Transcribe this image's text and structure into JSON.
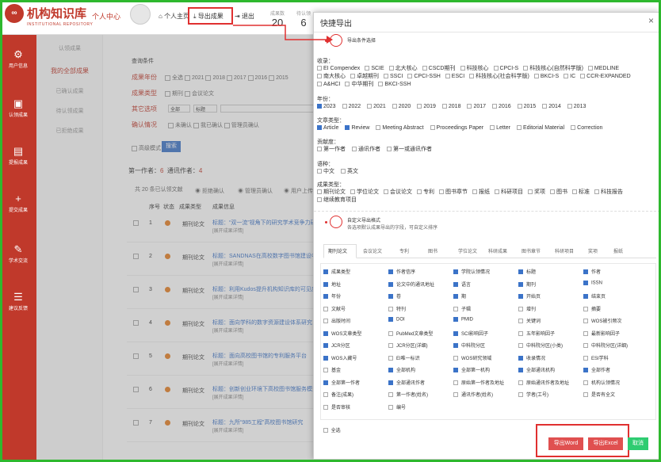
{
  "topbar": {
    "logo_text": "∞",
    "brand": "机构知识库",
    "brand_sub": "INSTITUTIONAL REPOSITORY",
    "user_center": "个人中心",
    "nav_home": "个人主页",
    "nav_export": "导出成果",
    "nav_logout": "退出",
    "stats": [
      {
        "label": "成果数",
        "value": "20"
      },
      {
        "label": "待认领",
        "value": "6"
      }
    ]
  },
  "sidebar": {
    "items": [
      {
        "icon": "⚙",
        "label": "用户信息"
      },
      {
        "icon": "▣",
        "label": "认领成果"
      },
      {
        "icon": "▤",
        "label": "提报成果"
      },
      {
        "icon": "+",
        "label": "提交成果"
      },
      {
        "icon": "✎",
        "label": "学术交流"
      },
      {
        "icon": "☰",
        "label": "建议反馈"
      }
    ]
  },
  "subnav": {
    "header": "认领成果",
    "all": "我的全部成果",
    "items": [
      "已确认成果",
      "待认领成果",
      "已拒绝成果"
    ]
  },
  "main": {
    "query_title": "查询条件",
    "label_year": "成果年份",
    "label_type": "成果类型",
    "label_other": "其它选项",
    "label_claim": "确认情况",
    "years": [
      "全选",
      "2021",
      "2018",
      "2017",
      "2016",
      "2015"
    ],
    "types": [
      "期刊",
      "会议论文"
    ],
    "other_select1": "全部",
    "other_select2": "标题",
    "claim_opts": [
      "未确认",
      "我已确认",
      "管理员确认"
    ],
    "advanced": "高级模式",
    "search": "搜索",
    "first_author": "第一作者：",
    "first_author_val": "6",
    "corr_author": "通讯作者：",
    "corr_author_val": "4",
    "total": "共 20 条已认领文献",
    "action1": "拒绝确认",
    "action2": "管理员确认",
    "action3": "用户上传",
    "col_num": "序号",
    "col_status": "状态",
    "col_type": "成果类型",
    "col_info": "成果信息",
    "rows": [
      {
        "num": "1",
        "type": "期刊论文",
        "title": "标题：“双一流”视角下的研究学术竞争力研究……",
        "sub": "[展开成果详情]"
      },
      {
        "num": "2",
        "type": "期刊论文",
        "title": "标题：SANDNAS在高校数字图书馆建设中的应用研究",
        "sub": "[展开成果详情]"
      },
      {
        "num": "3",
        "type": "期刊论文",
        "title": "标题：利用Kudos提升机构知识库的可见度",
        "sub": "[展开成果详情]"
      },
      {
        "num": "4",
        "type": "期刊论文",
        "title": "标题：面向学科的数字资源建设体系研究",
        "sub": "[展开成果详情]"
      },
      {
        "num": "5",
        "type": "期刊论文",
        "title": "标题：面向高校图书馆的专利服务平台",
        "sub": "[展开成果详情]"
      },
      {
        "num": "6",
        "type": "期刊论文",
        "title": "标题：创新创业环境下高校图书馆服务模式",
        "sub": "[展开成果详情]"
      },
      {
        "num": "7",
        "type": "期刊论文",
        "title": "标题：九所“985工程”高校图书馆研究",
        "sub": "[展开成果详情]"
      }
    ]
  },
  "modal": {
    "title": "快捷导出",
    "close": "×",
    "step1": "导出条件选择",
    "inc_label": "收录：",
    "inclusion": [
      [
        "EI Compendex",
        false
      ],
      [
        "SCIE",
        false
      ],
      [
        "北大核心",
        false
      ],
      [
        "CSCD期刊",
        false
      ],
      [
        "科技核心",
        false
      ],
      [
        "CPCI-S",
        false
      ],
      [
        "科技核心(自然科学版)",
        false
      ],
      [
        "MEDLINE",
        false
      ],
      [
        "南大核心",
        false
      ],
      [
        "卓越期刊",
        false
      ],
      [
        "SSCI",
        false
      ],
      [
        "CPCI-SSH",
        false
      ],
      [
        "ESCI",
        false
      ],
      [
        "科技核心(社会科学版)",
        false
      ],
      [
        "BKCI-S",
        false
      ],
      [
        "IC",
        false
      ],
      [
        "CCR-EXPANDED",
        false
      ],
      [
        "A&HCI",
        false
      ],
      [
        "中华期刊",
        false
      ],
      [
        "BKCI-SSH",
        false
      ]
    ],
    "year_label": "年份：",
    "years": [
      [
        "2023",
        true
      ],
      [
        "2022",
        false
      ],
      [
        "2021",
        false
      ],
      [
        "2020",
        false
      ],
      [
        "2019",
        false
      ],
      [
        "2018",
        false
      ],
      [
        "2017",
        false
      ],
      [
        "2016",
        false
      ],
      [
        "2015",
        false
      ],
      [
        "2014",
        false
      ],
      [
        "2013",
        false
      ]
    ],
    "doctype_label": "文章类型：",
    "doctypes": [
      [
        "Article",
        true
      ],
      [
        "Review",
        true
      ],
      [
        "Meeting Abstract",
        false
      ],
      [
        "Proceedings Paper",
        false
      ],
      [
        "Letter",
        false
      ],
      [
        "Editorial Material",
        false
      ],
      [
        "Correction",
        false
      ]
    ],
    "contrib_label": "贡献度：",
    "contribs": [
      [
        "第一作者",
        false
      ],
      [
        "通讯作者",
        false
      ],
      [
        "第一或通讯作者",
        false
      ]
    ],
    "lang_label": "语种：",
    "langs": [
      [
        "中文",
        false
      ],
      [
        "英文",
        false
      ]
    ],
    "restype_label": "成果类型：",
    "restypes": [
      [
        "期刊论文",
        false
      ],
      [
        "学位论文",
        false
      ],
      [
        "会议论文",
        false
      ],
      [
        "专利",
        false
      ],
      [
        "图书章节",
        false
      ],
      [
        "报纸",
        false
      ],
      [
        "科研项目",
        false
      ],
      [
        "奖项",
        false
      ],
      [
        "图书",
        false
      ],
      [
        "标准",
        false
      ],
      [
        "科技报告",
        false
      ],
      [
        "继续教育项目",
        false
      ]
    ],
    "step2": "自定义导出格式",
    "step2_sub": "各选项默认成果导出的字段，可自定义排序",
    "tabs": [
      "期刊论文",
      "会议论文",
      "专利",
      "图书",
      "学位论文",
      "科研成果",
      "图书章节",
      "科研项目",
      "奖项",
      "报纸"
    ],
    "fields": [
      [
        "成果类型",
        true
      ],
      [
        "作者信序",
        true
      ],
      [
        "学院认领情况",
        true
      ],
      [
        "标题",
        true
      ],
      [
        "作者",
        true
      ],
      [
        "地址",
        true
      ],
      [
        "论文中的通讯地址",
        true
      ],
      [
        "语言",
        true
      ],
      [
        "期刊",
        true
      ],
      [
        "ISSN",
        true
      ],
      [
        "年份",
        true
      ],
      [
        "卷",
        true
      ],
      [
        "期",
        true
      ],
      [
        "开始页",
        true
      ],
      [
        "结束页",
        true
      ],
      [
        "文献号",
        false
      ],
      [
        "特刊",
        false
      ],
      [
        "子辑",
        false
      ],
      [
        "增刊",
        false
      ],
      [
        "摘要",
        false
      ],
      [
        "出版时间",
        false
      ],
      [
        "DOI",
        true
      ],
      [
        "PMID",
        true
      ],
      [
        "关键词",
        false
      ],
      [
        "WOS被引频次",
        false
      ],
      [
        "WOS文章类型",
        true
      ],
      [
        "PubMed文章类型",
        false
      ],
      [
        "SCI影响因子",
        true
      ],
      [
        "五年影响因子",
        false
      ],
      [
        "最新影响因子",
        false
      ],
      [
        "JCR分区",
        true
      ],
      [
        "JCR分区(详细)",
        false
      ],
      [
        "中科院分区",
        true
      ],
      [
        "中科院分区(小类)",
        false
      ],
      [
        "中科院分区(详细)",
        false
      ],
      [
        "WOS入藏号",
        true
      ],
      [
        "EI唯一标识",
        false
      ],
      [
        "WOS研究领域",
        false
      ],
      [
        "收录情况",
        true
      ],
      [
        "ESI学科",
        false
      ],
      [
        "基金",
        false
      ],
      [
        "全部机构",
        true
      ],
      [
        "全部第一机构",
        true
      ],
      [
        "全部通讯机构",
        true
      ],
      [
        "全部作者",
        true
      ],
      [
        "全部第一作者",
        true
      ],
      [
        "全部通讯作者",
        true
      ],
      [
        "原始第一作者及地址",
        false
      ],
      [
        "原始通讯作者及地址",
        false
      ],
      [
        "机构认领情况",
        false
      ],
      [
        "备注(成果)",
        false
      ],
      [
        "第一作者(姓名)",
        false
      ],
      [
        "通讯作者(姓名)",
        false
      ],
      [
        "学者(工号)",
        false
      ],
      [
        "是否有全文",
        false
      ],
      [
        "是否审核",
        false
      ],
      [
        "编号",
        false
      ]
    ],
    "select_all": "全选",
    "btn_word": "导出Word",
    "btn_excel": "导出Excel",
    "btn_cancel": "取消"
  },
  "colors": {
    "brand_red": "#c0392b",
    "highlight": "#e03030",
    "frame_green": "#2eb82e",
    "checked_blue": "#3b73c8"
  }
}
